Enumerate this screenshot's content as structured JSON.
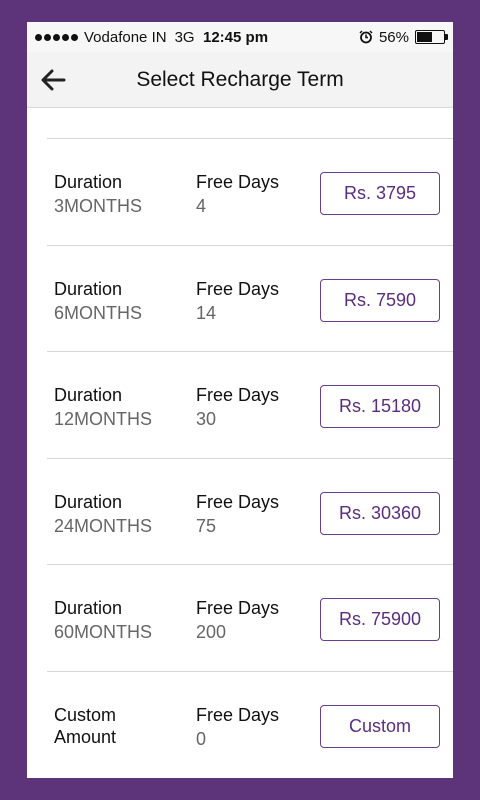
{
  "status_bar": {
    "carrier": "Vodafone IN",
    "network": "3G",
    "time": "12:45 pm",
    "battery": "56%",
    "battery_level": 0.56
  },
  "header": {
    "title": "Select Recharge Term",
    "back_icon": "arrow-left-icon"
  },
  "rows": [
    {
      "duration_label": "Duration",
      "duration_value": "3MONTHS",
      "free_label": "Free Days",
      "free_value": "4",
      "price": "Rs. 3795"
    },
    {
      "duration_label": "Duration",
      "duration_value": "6MONTHS",
      "free_label": "Free Days",
      "free_value": "14",
      "price": "Rs. 7590"
    },
    {
      "duration_label": "Duration",
      "duration_value": "12MONTHS",
      "free_label": "Free Days",
      "free_value": "30",
      "price": "Rs. 15180"
    },
    {
      "duration_label": "Duration",
      "duration_value": "24MONTHS",
      "free_label": "Free Days",
      "free_value": "75",
      "price": "Rs. 30360"
    },
    {
      "duration_label": "Duration",
      "duration_value": "60MONTHS",
      "free_label": "Free Days",
      "free_value": "200",
      "price": "Rs. 75900"
    }
  ],
  "custom_row": {
    "label": "Custom Amount",
    "free_label": "Free Days",
    "free_value": "0",
    "button": "Custom"
  },
  "colors": {
    "background": "#5d3379",
    "accent": "#6a3d8e",
    "button_text": "#5b2d80"
  }
}
